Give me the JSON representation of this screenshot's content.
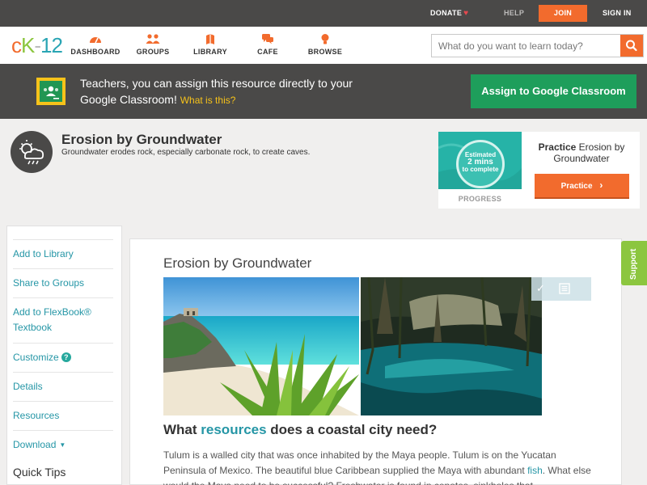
{
  "topbar": {
    "donate": "DONATE",
    "help": "HELP",
    "join": "JOIN",
    "signin": "SIGN IN"
  },
  "logo": {
    "part1": "c",
    "part2": "K",
    "part3": "-",
    "part4": "12"
  },
  "nav": {
    "items": [
      {
        "label": "DASHBOARD",
        "icon": "dashboard-icon"
      },
      {
        "label": "GROUPS",
        "icon": "groups-icon"
      },
      {
        "label": "LIBRARY",
        "icon": "library-icon"
      },
      {
        "label": "CAFE",
        "icon": "cafe-icon"
      },
      {
        "label": "BROWSE",
        "icon": "browse-icon"
      }
    ],
    "search_placeholder": "What do you want to learn today?"
  },
  "banner": {
    "message": "Teachers, you can assign this resource directly to your Google Classroom!",
    "what_link": "What is this?",
    "assign_label": "Assign to Google Classroom"
  },
  "header": {
    "title": "Erosion by Groundwater",
    "subtitle": "Groundwater erodes rock, especially carbonate rock, to create caves."
  },
  "practice": {
    "estimate_line1": "Estimated",
    "estimate_mins": "2 mins",
    "estimate_line3": "to complete",
    "progress_label": "PROGRESS",
    "title_bold": "Practice",
    "title_rest": "Erosion by Groundwater",
    "button_label": "Practice"
  },
  "sidebar": {
    "items": [
      {
        "label": "Add to Library"
      },
      {
        "label": "Share to Groups"
      },
      {
        "label": "Add to FlexBook® Textbook"
      },
      {
        "label": "Customize"
      },
      {
        "label": "Details"
      },
      {
        "label": "Resources"
      },
      {
        "label": "Download"
      }
    ],
    "customize_badge": "?",
    "quick_tips": "Quick Tips"
  },
  "content": {
    "title": "Erosion by Groundwater",
    "question_pre": "What ",
    "question_kw": "resources",
    "question_post": " does a coastal city need?",
    "para_1": "Tulum is a walled city that was once inhabited by the Maya people. Tulum is on the Yucatan Peninsula of Mexico. The beautiful blue Caribbean supplied the Maya with abundant ",
    "para_link": "fish",
    "para_2": ". What else would the Maya need to be successful? Freshwater is found in cenotes, sinkholes that"
  },
  "support": {
    "label": "Support"
  },
  "colors": {
    "dark_bar": "#4a4948",
    "accent_orange": "#f26b2d",
    "accent_green": "#1e9e5b",
    "link_teal": "#2596a6",
    "support_green": "#8cc63f"
  }
}
